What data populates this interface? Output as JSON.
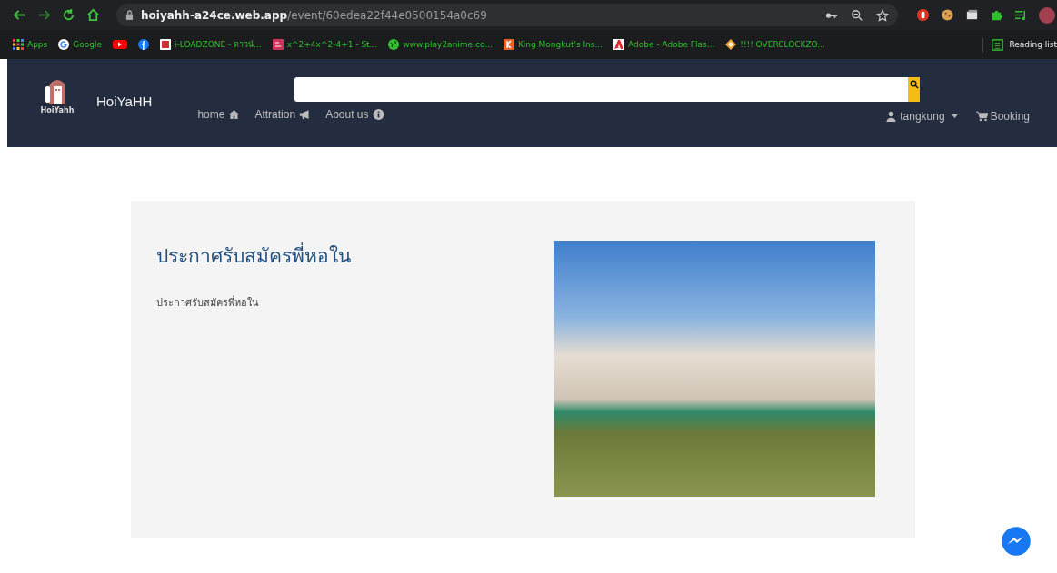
{
  "browser": {
    "url_host": "hoiyahh-a24ce.web.app",
    "url_path": "/event/60edea22f44e0500154a0c69",
    "bookmarks": [
      {
        "kind": "apps",
        "label": "Apps"
      },
      {
        "kind": "google",
        "label": "Google"
      },
      {
        "kind": "youtube"
      },
      {
        "kind": "facebook"
      },
      {
        "kind": "lz",
        "label": "i-LOADZONE - ดาวน์..."
      },
      {
        "kind": "sy",
        "label": "x^2+4x^2-4+1 - St..."
      },
      {
        "kind": "globe",
        "label": "www.play2anime.co..."
      },
      {
        "kind": "k",
        "label": "King Mongkut's Ins..."
      },
      {
        "kind": "adobe",
        "label": "Adobe - Adobe Flas..."
      },
      {
        "kind": "diamond",
        "label": "!!!! OVERCLOCKZO..."
      }
    ],
    "reading_list": "Reading list"
  },
  "navbar": {
    "logo_caption": "HoiYahh",
    "brand": "HoiYaHH",
    "links": [
      {
        "label": "home",
        "kind": "home"
      },
      {
        "label": "Attration",
        "kind": "announce"
      },
      {
        "label": "About us",
        "kind": "about"
      }
    ],
    "user": "tangkung",
    "booking": "Booking"
  },
  "event": {
    "title": "ประกาศรับสมัครพี่หอใน",
    "description": "ประกาศรับสมัครพี่หอใน"
  }
}
